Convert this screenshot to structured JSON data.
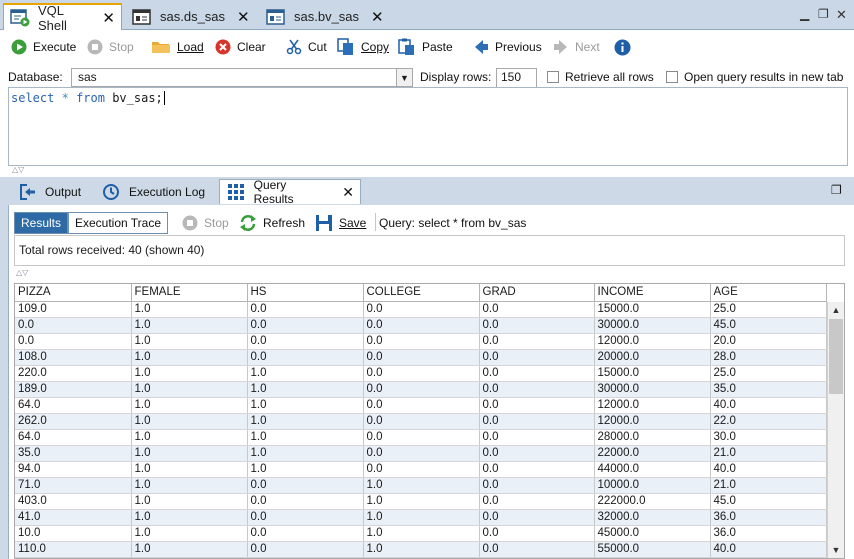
{
  "editor_tabs": [
    {
      "label": "VQL Shell",
      "icon": "vql-shell-icon",
      "active": true
    },
    {
      "label": "sas.ds_sas",
      "icon": "datasource-icon",
      "active": false
    },
    {
      "label": "sas.bv_sas",
      "icon": "base-view-icon",
      "active": false
    }
  ],
  "toolbar": {
    "execute": "Execute",
    "stop": "Stop",
    "load": "Load",
    "clear": "Clear",
    "cut": "Cut",
    "copy": "Copy",
    "paste": "Paste",
    "previous": "Previous",
    "next": "Next"
  },
  "options": {
    "database_label": "Database:",
    "database_value": "sas",
    "display_rows_label": "Display rows:",
    "display_rows_value": "150",
    "retrieve_all": "Retrieve all rows",
    "open_new_tab": "Open query results in new tab"
  },
  "query": {
    "kw1": "select",
    "star": "*",
    "kw2": "from",
    "rest": "bv_sas;"
  },
  "panel_tabs": {
    "output": "Output",
    "execution_log": "Execution Log",
    "query_results": "Query Results"
  },
  "results_bar": {
    "results": "Results",
    "execution_trace": "Execution Trace",
    "stop": "Stop",
    "refresh": "Refresh",
    "save": "Save",
    "query_text": "Query: select * from bv_sas"
  },
  "summary": "Total rows received: 40 (shown 40)",
  "table": {
    "columns": [
      "PIZZA",
      "FEMALE",
      "HS",
      "COLLEGE",
      "GRAD",
      "INCOME",
      "AGE"
    ],
    "rows": [
      [
        "109.0",
        "1.0",
        "0.0",
        "0.0",
        "0.0",
        "15000.0",
        "25.0"
      ],
      [
        "0.0",
        "1.0",
        "0.0",
        "0.0",
        "0.0",
        "30000.0",
        "45.0"
      ],
      [
        "0.0",
        "1.0",
        "0.0",
        "0.0",
        "0.0",
        "12000.0",
        "20.0"
      ],
      [
        "108.0",
        "1.0",
        "0.0",
        "0.0",
        "0.0",
        "20000.0",
        "28.0"
      ],
      [
        "220.0",
        "1.0",
        "1.0",
        "0.0",
        "0.0",
        "15000.0",
        "25.0"
      ],
      [
        "189.0",
        "1.0",
        "1.0",
        "0.0",
        "0.0",
        "30000.0",
        "35.0"
      ],
      [
        "64.0",
        "1.0",
        "1.0",
        "0.0",
        "0.0",
        "12000.0",
        "40.0"
      ],
      [
        "262.0",
        "1.0",
        "1.0",
        "0.0",
        "0.0",
        "12000.0",
        "22.0"
      ],
      [
        "64.0",
        "1.0",
        "1.0",
        "0.0",
        "0.0",
        "28000.0",
        "30.0"
      ],
      [
        "35.0",
        "1.0",
        "1.0",
        "0.0",
        "0.0",
        "22000.0",
        "21.0"
      ],
      [
        "94.0",
        "1.0",
        "1.0",
        "0.0",
        "0.0",
        "44000.0",
        "40.0"
      ],
      [
        "71.0",
        "1.0",
        "0.0",
        "1.0",
        "0.0",
        "10000.0",
        "21.0"
      ],
      [
        "403.0",
        "1.0",
        "0.0",
        "1.0",
        "0.0",
        "222000.0",
        "45.0"
      ],
      [
        "41.0",
        "1.0",
        "0.0",
        "1.0",
        "0.0",
        "32000.0",
        "36.0"
      ],
      [
        "10.0",
        "1.0",
        "0.0",
        "1.0",
        "0.0",
        "45000.0",
        "36.0"
      ],
      [
        "110.0",
        "1.0",
        "0.0",
        "1.0",
        "0.0",
        "55000.0",
        "40.0"
      ]
    ]
  }
}
